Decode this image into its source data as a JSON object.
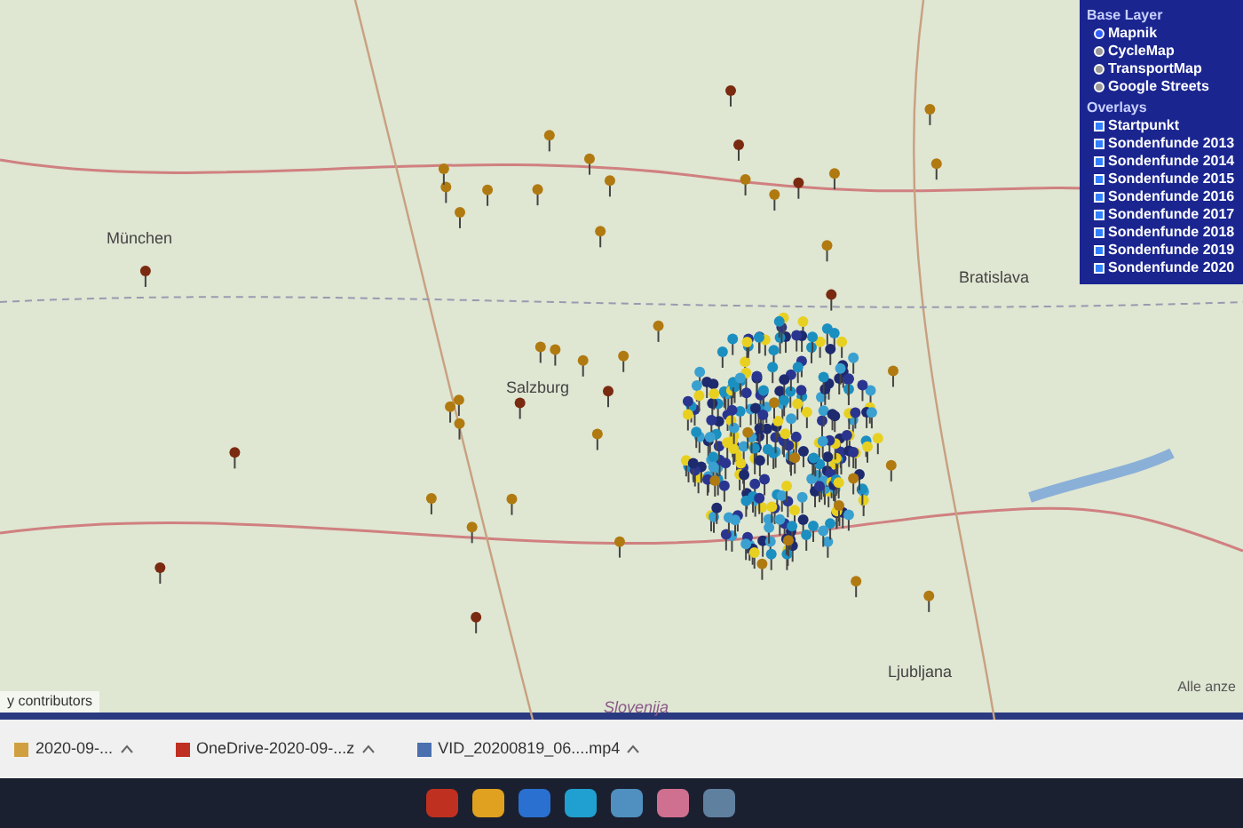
{
  "map": {
    "labels": [
      {
        "text": "München",
        "kind": "city"
      },
      {
        "text": "Salzburg",
        "kind": "city"
      },
      {
        "text": "Bratislava",
        "kind": "city"
      },
      {
        "text": "Ljubljana",
        "kind": "city"
      },
      {
        "text": "Slovenija",
        "kind": "region"
      }
    ],
    "attribution": "y contributors",
    "corner_text": "Alle anze"
  },
  "layer_panel": {
    "base_title": "Base Layer",
    "base_layers": [
      {
        "label": "Mapnik",
        "selected": true
      },
      {
        "label": "CycleMap",
        "selected": false
      },
      {
        "label": "TransportMap",
        "selected": false
      },
      {
        "label": "Google Streets",
        "selected": false
      }
    ],
    "overlays_title": "Overlays",
    "overlays": [
      {
        "label": "Startpunkt",
        "checked": true
      },
      {
        "label": "Sondenfunde 2013",
        "checked": true
      },
      {
        "label": "Sondenfunde 2014",
        "checked": true
      },
      {
        "label": "Sondenfunde 2015",
        "checked": true
      },
      {
        "label": "Sondenfunde 2016",
        "checked": true
      },
      {
        "label": "Sondenfunde 2017",
        "checked": true
      },
      {
        "label": "Sondenfunde 2018",
        "checked": true
      },
      {
        "label": "Sondenfunde 2019",
        "checked": true
      },
      {
        "label": "Sondenfunde 2020",
        "checked": true
      }
    ]
  },
  "downloads": [
    {
      "name": "2020-09-...",
      "kind": "folder"
    },
    {
      "name": "OneDrive-2020-09-...z",
      "kind": "zip"
    },
    {
      "name": "VID_20200819_06....mp4",
      "kind": "video"
    }
  ]
}
